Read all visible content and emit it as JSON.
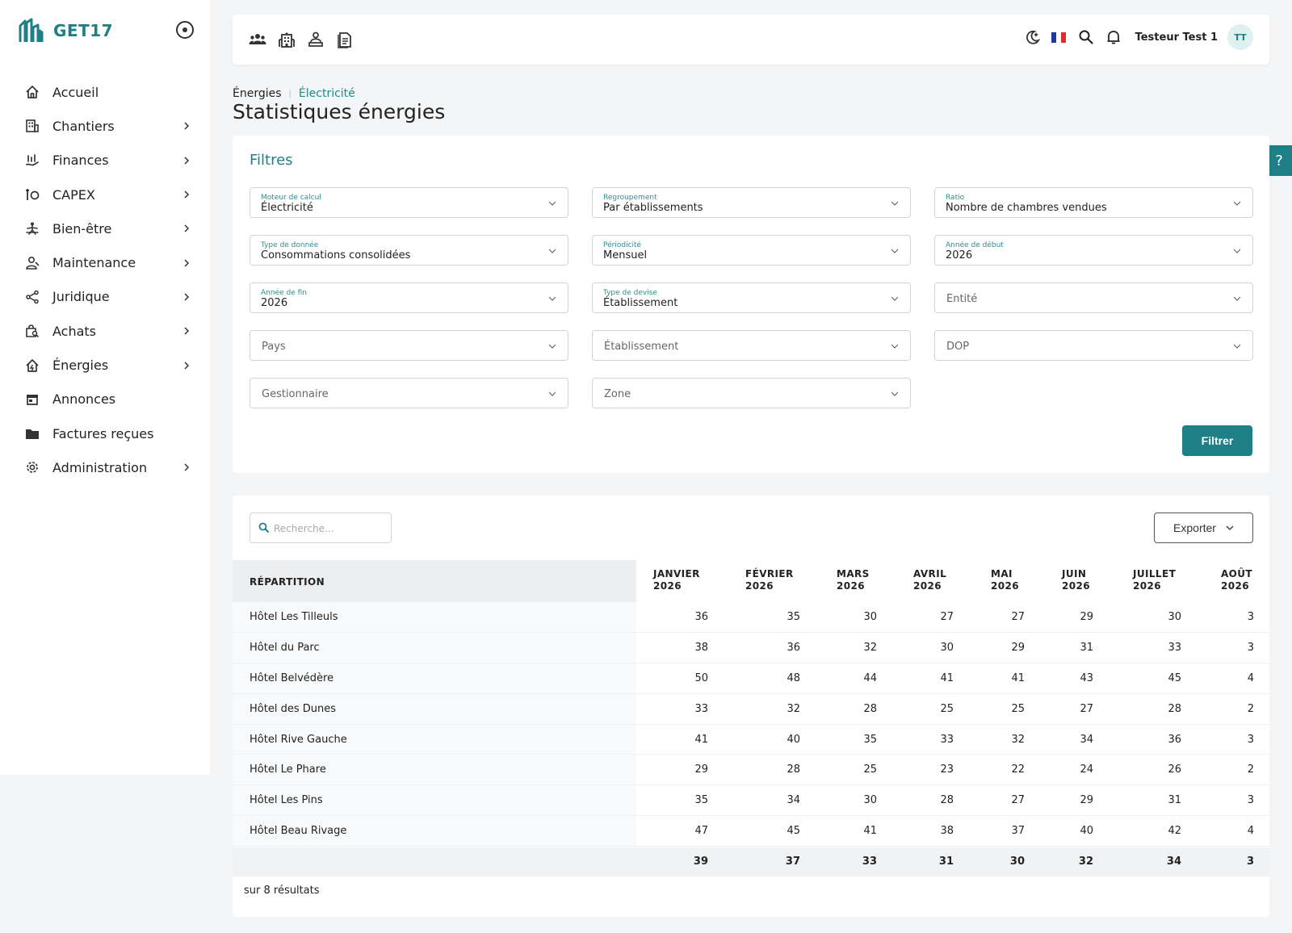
{
  "app": {
    "name": "GET17"
  },
  "sidebar": {
    "items": [
      {
        "label": "Accueil",
        "icon": "home-icon",
        "has_children": false
      },
      {
        "label": "Chantiers",
        "icon": "building-icon",
        "has_children": true
      },
      {
        "label": "Finances",
        "icon": "chart-hand-icon",
        "has_children": true
      },
      {
        "label": "CAPEX",
        "icon": "wrench-coin-icon",
        "has_children": true
      },
      {
        "label": "Bien-être",
        "icon": "person-relax-icon",
        "has_children": true
      },
      {
        "label": "Maintenance",
        "icon": "worker-icon",
        "has_children": true
      },
      {
        "label": "Juridique",
        "icon": "share-icon",
        "has_children": true
      },
      {
        "label": "Achats",
        "icon": "shopping-bag-search-icon",
        "has_children": true
      },
      {
        "label": "Énergies",
        "icon": "house-energy-icon",
        "has_children": true
      },
      {
        "label": "Annonces",
        "icon": "store-icon",
        "has_children": false
      },
      {
        "label": "Factures reçues",
        "icon": "folder-icon",
        "has_children": false
      },
      {
        "label": "Administration",
        "icon": "gear-icon",
        "has_children": true
      }
    ]
  },
  "topbar": {
    "left_icons": [
      "users-icon",
      "hotel-icon",
      "receptionist-icon",
      "document-icon"
    ],
    "right_icons": [
      "dark-mode-icon",
      "flag-fr-icon",
      "search-icon",
      "bell-icon"
    ],
    "user_name": "Testeur Test 1",
    "avatar_initials": "TT"
  },
  "breadcrumb": {
    "parent": "Énergies",
    "current": "Électricité"
  },
  "page_title": "Statistiques énergies",
  "help_label": "?",
  "filters": {
    "title": "Filtres",
    "fields": [
      {
        "label": "Moteur de calcul",
        "value": "Électricité"
      },
      {
        "label": "Regroupement",
        "value": "Par établissements"
      },
      {
        "label": "Ratio",
        "value": "Nombre de chambres vendues"
      },
      {
        "label": "Type de donnée",
        "value": "Consommations consolidées"
      },
      {
        "label": "Périodicité",
        "value": "Mensuel"
      },
      {
        "label": "Année de début",
        "value": "2026"
      },
      {
        "label": "Année de fin",
        "value": "2026"
      },
      {
        "label": "Type de devise",
        "value": "Établissement"
      },
      {
        "placeholder": "Entité"
      },
      {
        "placeholder": "Pays"
      },
      {
        "placeholder": "Établissement"
      },
      {
        "placeholder": "DOP"
      },
      {
        "placeholder": "Gestionnaire"
      },
      {
        "placeholder": "Zone"
      }
    ],
    "submit_label": "Filtrer"
  },
  "table": {
    "search_placeholder": "Recherche...",
    "export_label": "Exporter",
    "first_header": "RÉPARTITION",
    "months": [
      {
        "l1": "JANVIER",
        "l2": "2026"
      },
      {
        "l1": "FÉVRIER",
        "l2": "2026"
      },
      {
        "l1": "MARS",
        "l2": "2026"
      },
      {
        "l1": "AVRIL",
        "l2": "2026"
      },
      {
        "l1": "MAI",
        "l2": "2026"
      },
      {
        "l1": "JUIN",
        "l2": "2026"
      },
      {
        "l1": "JUILLET",
        "l2": "2026"
      },
      {
        "l1": "AOÛT",
        "l2": "2026"
      }
    ],
    "rows": [
      {
        "name": "Hôtel Les Tilleuls",
        "values": [
          "36",
          "35",
          "30",
          "27",
          "27",
          "29",
          "30",
          "3"
        ]
      },
      {
        "name": "Hôtel du Parc",
        "values": [
          "38",
          "36",
          "32",
          "30",
          "29",
          "31",
          "33",
          "3"
        ]
      },
      {
        "name": "Hôtel Belvédère",
        "values": [
          "50",
          "48",
          "44",
          "41",
          "41",
          "43",
          "45",
          "4"
        ]
      },
      {
        "name": "Hôtel des Dunes",
        "values": [
          "33",
          "32",
          "28",
          "25",
          "25",
          "27",
          "28",
          "2"
        ]
      },
      {
        "name": "Hôtel Rive Gauche",
        "values": [
          "41",
          "40",
          "35",
          "33",
          "32",
          "34",
          "36",
          "3"
        ]
      },
      {
        "name": "Hôtel Le Phare",
        "values": [
          "29",
          "28",
          "25",
          "23",
          "22",
          "24",
          "26",
          "2"
        ]
      },
      {
        "name": "Hôtel Les Pins",
        "values": [
          "35",
          "34",
          "30",
          "28",
          "27",
          "29",
          "31",
          "3"
        ]
      },
      {
        "name": "Hôtel Beau Rivage",
        "values": [
          "47",
          "45",
          "41",
          "38",
          "37",
          "40",
          "42",
          "4"
        ]
      }
    ],
    "totals": [
      "39",
      "37",
      "33",
      "31",
      "30",
      "32",
      "34",
      "3"
    ],
    "results_text": "sur 8 résultats"
  },
  "colors": {
    "accent": "#1f7f86",
    "background": "#f4f5f6"
  }
}
